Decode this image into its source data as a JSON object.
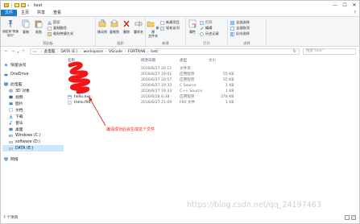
{
  "window": {
    "title": "test",
    "controls": [
      "—",
      "☐",
      "✕"
    ]
  },
  "menu": {
    "tabs": [
      "文件",
      "主页",
      "共享",
      "查看"
    ],
    "help": "?"
  },
  "ribbon": {
    "groups": [
      "剪贴板",
      "组织",
      "新建",
      "打开",
      "选择"
    ],
    "buttons": {
      "pin": "固定到\"快速访问\"",
      "copy": "复制",
      "paste": "粘贴",
      "cut": "剪切",
      "copy_path": "复制路径",
      "paste_shortcut": "粘贴快捷方式",
      "move_to": "移动到",
      "copy_to": "复制到",
      "delete": "删除",
      "rename": "重命名",
      "new_folder": "新建\n文件夹",
      "new_item": "新建项目",
      "easy_access": "轻松访问",
      "properties": "属性",
      "open": "打开",
      "edit": "编辑",
      "history": "历史记录",
      "select_all": "全部选择",
      "select_none": "全部取消",
      "invert": "反向选择"
    }
  },
  "address": {
    "crumbs": [
      "此电脑",
      "DATA (E:)",
      "workspace",
      "VScode",
      "FORTRAN",
      "test"
    ],
    "search_placeholder": "搜索\"test\""
  },
  "sidebar": {
    "items": [
      {
        "label": "快速访问",
        "level": 0
      },
      {
        "label": "OneDrive",
        "level": 0
      },
      {
        "label": "此电脑",
        "level": 0
      },
      {
        "label": "3D 对象",
        "level": 1
      },
      {
        "label": "视频",
        "level": 1
      },
      {
        "label": "图片",
        "level": 1
      },
      {
        "label": "文档",
        "level": 1
      },
      {
        "label": "下载",
        "level": 1
      },
      {
        "label": "音乐",
        "level": 1
      },
      {
        "label": "桌面",
        "level": 1
      },
      {
        "label": "Windows (C:)",
        "level": 1
      },
      {
        "label": "software (D:)",
        "level": 1
      },
      {
        "label": "DATA (E:)",
        "level": 1,
        "selected": true
      },
      {
        "label": "网络",
        "level": 0
      }
    ]
  },
  "columns": [
    "名称",
    "修改日期",
    "类型",
    "大小"
  ],
  "files": [
    {
      "name": "",
      "date": "2016/6/27 20:11",
      "type": "文件夹",
      "size": ""
    },
    {
      "name": "",
      "date": "2016/6/27 19:01",
      "type": "应用程序",
      "size": "55 KB"
    },
    {
      "name": "",
      "date": "2016/6/27 20:57",
      "type": "应用程序",
      "size": "55 KB"
    },
    {
      "name": "",
      "date": "2016/6/27 19:33",
      "type": "C Source",
      "size": "1 KB"
    },
    {
      "name": "",
      "date": "2016/6/27 19:33",
      "type": "C++ Source",
      "size": "1 KB"
    },
    {
      "name": "hello.exe",
      "date": "2016/6/28 6:38",
      "type": "应用程序",
      "size": "378 KB"
    },
    {
      "name": "Hello.f90",
      "date": "2016/6/27 21:09",
      "type": "F90 文件",
      "size": "1 KB"
    }
  ],
  "annotation": "编译成功后会生成这个文件",
  "status": "7 个项目",
  "watermark": "https://blog.csdn.net/qq_24197463",
  "colors": {
    "accent": "#1979ca",
    "annotation_red": "#e8231b",
    "selected_bg": "#cce8ff"
  }
}
